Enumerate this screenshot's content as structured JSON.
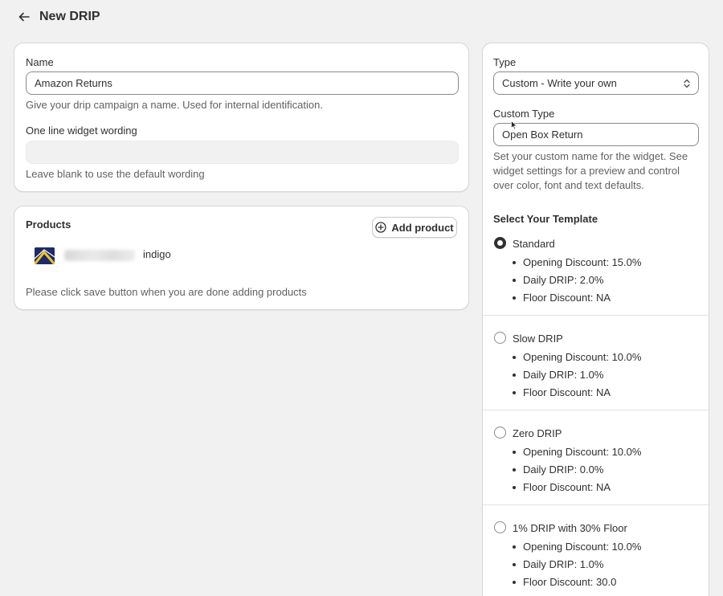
{
  "header": {
    "title": "New DRIP"
  },
  "name_card": {
    "name_label": "Name",
    "name_value": "Amazon Returns",
    "name_help": "Give your drip campaign a name. Used for internal identification.",
    "wording_label": "One line widget wording",
    "wording_value": "",
    "wording_help": "Leave blank to use the default wording"
  },
  "products_card": {
    "title": "Products",
    "add_button": "Add product",
    "product_name": "indigo",
    "help": "Please click save button when you are done adding products"
  },
  "type_card": {
    "type_label": "Type",
    "type_value": "Custom - Write your own",
    "custom_type_label": "Custom Type",
    "custom_type_value": "Open Box Return",
    "custom_help": "Set your custom name for the widget. See widget settings for a preview and control over color, font and text defaults.",
    "template_title": "Select Your Template",
    "templates": [
      {
        "name": "Standard",
        "selected": true,
        "lines": [
          "Opening Discount: 15.0%",
          "Daily DRIP: 2.0%",
          "Floor Discount: NA"
        ]
      },
      {
        "name": "Slow DRIP",
        "selected": false,
        "lines": [
          "Opening Discount: 10.0%",
          "Daily DRIP: 1.0%",
          "Floor Discount: NA"
        ]
      },
      {
        "name": "Zero DRIP",
        "selected": false,
        "lines": [
          "Opening Discount: 10.0%",
          "Daily DRIP: 0.0%",
          "Floor Discount: NA"
        ]
      },
      {
        "name": "1% DRIP with 30% Floor",
        "selected": false,
        "lines": [
          "Opening Discount: 10.0%",
          "Daily DRIP: 1.0%",
          "Floor Discount: 30.0"
        ]
      }
    ]
  },
  "colors": {
    "background": "#f1f1f1",
    "text": "#303030",
    "muted": "#616161",
    "product_thumb": "#1d2b6b"
  },
  "icons": {
    "back": "arrow-left-icon",
    "add": "plus-circle-icon",
    "select": "select-arrows-icon"
  }
}
